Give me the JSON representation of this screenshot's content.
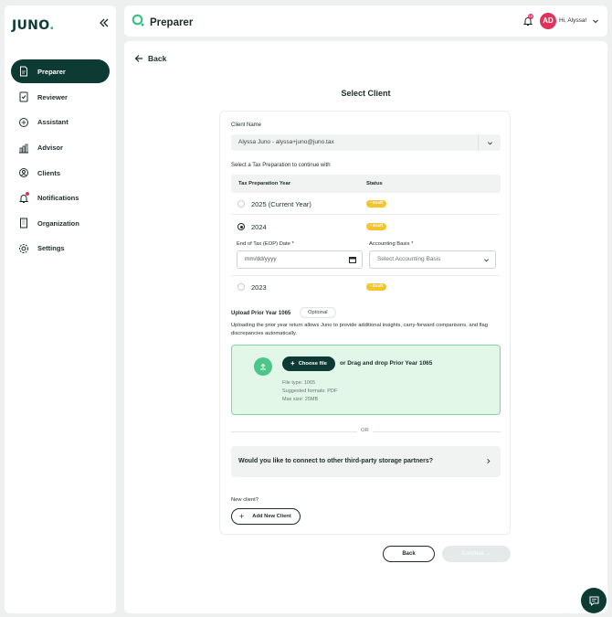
{
  "sidebar": {
    "logo": "JUNO",
    "logo_dot": ".",
    "items": [
      {
        "label": "Preparer",
        "icon": "document-icon",
        "active": true
      },
      {
        "label": "Reviewer",
        "icon": "review-icon"
      },
      {
        "label": "Assistant",
        "icon": "assistant-icon"
      },
      {
        "label": "Advisor",
        "icon": "chart-icon"
      },
      {
        "label": "Clients",
        "icon": "clients-icon"
      },
      {
        "label": "Notifications",
        "icon": "bell-icon"
      },
      {
        "label": "Organization",
        "icon": "building-icon"
      },
      {
        "label": "Settings",
        "icon": "gear-icon"
      }
    ]
  },
  "header": {
    "title": "Preparer",
    "notification_count": "15",
    "avatar_initials": "AD",
    "greeting": "Hi, Alyssa!"
  },
  "main": {
    "back_label": "Back",
    "page_title": "Select Client",
    "client_name_label": "Client Name",
    "client_value": "Alyssa Juno - alyssa+juno@juno.tax",
    "tax_prep_prompt": "Select a Tax Preparation to continue with",
    "table_headers": {
      "year": "Tax Preparation Year",
      "status": "Status"
    },
    "rows": [
      {
        "year": "2025 (Current Year)",
        "status": "• Draft",
        "selected": false
      },
      {
        "year": "2024",
        "status": "• Draft",
        "selected": true
      },
      {
        "year": "2023",
        "status": "• Draft",
        "selected": false
      }
    ],
    "eop_label": "End of Tax (EOP) Date *",
    "eop_placeholder": "mm/dd/yyyy",
    "basis_label": "Accounting Basis *",
    "basis_placeholder": "Select Accounting Basis",
    "upload_title": "Upload Prior Year 1065",
    "optional_label": "Optional",
    "upload_desc": "Uploading the prior year return allows Juno to provide additional insights, carry-forward comparisons, and flag discrepancies automatically.",
    "choose_file_label": "Choose file",
    "drag_drop_prefix": "or Drag and drop",
    "drag_drop_target": "Prior Year 1065",
    "file_type": "File type: 1065",
    "suggested_formats": "Suggested formats: PDF",
    "max_size": "Max size: 25MB",
    "or_label": "OR",
    "third_party_label": "Would you like to connect to other third-party storage partners?",
    "new_client_label": "New client?",
    "add_client_label": "Add New Client",
    "back_button": "Back",
    "continue_button": "Continue"
  },
  "colors": {
    "brand_dark": "#0e3a34",
    "brand_green": "#2ec27e",
    "draft_badge": "#f5c428",
    "accent_red": "#e0335b",
    "dropzone_bg": "#e3f7e9"
  }
}
